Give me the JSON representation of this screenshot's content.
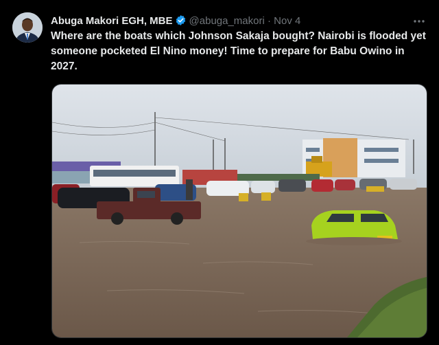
{
  "tweet": {
    "author_name": "Abuga Makori EGH, MBE",
    "handle": "@abuga_makori",
    "separator": "·",
    "date": "Nov 4",
    "text": "Where are the boats which Johnson Sakaja bought? Nairobi is flooded yet someone pocketed El Nino money! Time to prepare for Babu Owino in 2027.",
    "verified_badge_color": "#1d9bf0",
    "icons": [
      "verified-badge-icon",
      "more-options-icon"
    ],
    "media": {
      "kind": "photo"
    }
  },
  "colors": {
    "background": "#000000",
    "text_primary": "#e7e9ea",
    "text_secondary": "#71767b",
    "border": "#2f3336"
  }
}
